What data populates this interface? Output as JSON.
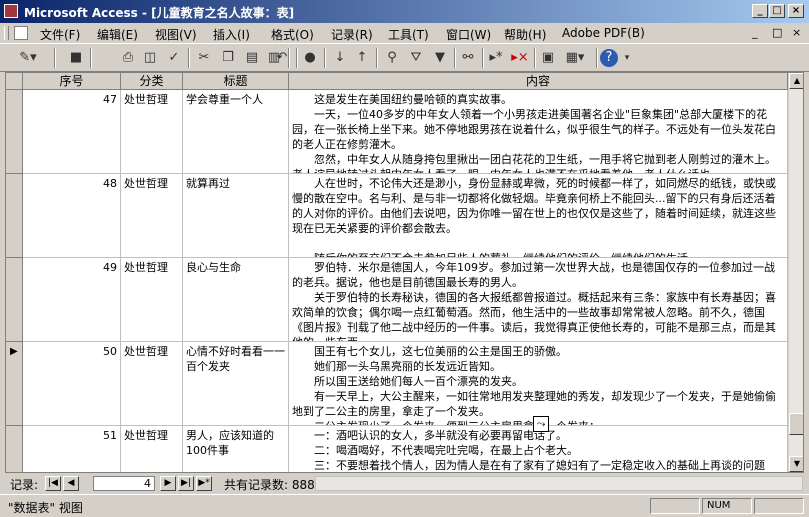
{
  "window": {
    "title": "Microsoft Access - [儿童教育之名人故事：表]",
    "minimize_glyph": "_",
    "restore_glyph": "□",
    "close_glyph": "×"
  },
  "menu": {
    "items": [
      "文件(F)",
      "编辑(E)",
      "视图(V)",
      "插入(I)",
      "格式(O)",
      "记录(R)",
      "工具(T)",
      "窗口(W)",
      "帮助(H)",
      "Adobe PDF(B)"
    ],
    "help_placeholder": "",
    "doc_controls": [
      "_",
      "□",
      "×"
    ]
  },
  "toolbar": {
    "icons": [
      "view-icon",
      "save-icon",
      "print-icon",
      "print-preview-icon",
      "spelling-icon",
      "cut-icon",
      "copy-icon",
      "paste-icon",
      "format-painter-icon",
      "undo-icon",
      "hyperlink-icon",
      "sort-ascending-icon",
      "sort-descending-icon",
      "filter-by-selection-icon",
      "filter-by-form-icon",
      "apply-filter-icon",
      "find-icon",
      "new-record-icon",
      "delete-record-icon",
      "database-window-icon",
      "new-object-icon",
      "help-icon"
    ]
  },
  "columns": [
    "序号",
    "分类",
    "标题",
    "内容"
  ],
  "rows": [
    {
      "num": "47",
      "category": "处世哲理",
      "title": "学会尊重一个人",
      "content": "　　这是发生在美国纽约曼哈顿的真实故事。\n　　一天，一位40多岁的中年女人领着一个小男孩走进美国著名企业\"巨象集团\"总部大厦楼下的花园，在一张长椅上坐下来。她不停地跟男孩在说着什么，似乎很生气的样子。不远处有一位头发花白的老人正在修剪灌木。\n　　忽然，中年女人从随身挎包里揪出一团白花花的卫生纸，一甩手将它抛到老人刚剪过的灌木上。老人诧异地转过头朝中年女人看了一眼。中年女人也满不在乎地看着他。老人什么话也"
    },
    {
      "num": "48",
      "category": "处世哲理",
      "title": "就算再过",
      "content": "　　人在世时，不论伟大还是渺小，身份显赫或卑微，死的时候都一样了，如同燃尽的纸钱，或快或慢的散在空中。名与利、是与非一切都将化做轻烟。毕竟亲何桥上不能回头...留下的只有身后还活着的人对你的评价。由他们去说吧，因为你唯一留在世上的也仅仅是这些了，随着时间延续，就连这些现在已无关紧要的评价都会散去。\n\n　　随后你的至交们不会去参加另些人的葬礼，继续他们的评价，继续他们的生活。"
    },
    {
      "num": "49",
      "category": "处世哲理",
      "title": "良心与生命",
      "content": "　　罗伯特．米尔是德国人，今年109岁。参加过第一次世界大战，也是德国仅存的一位参加过一战的老兵。据说，他也是目前德国最长寿的男人。\n　　关于罗伯特的长寿秘诀，德国的各大报纸都曾报道过。概括起来有三条：家族中有长寿基因；喜欢简单的饮食；偶尔喝一点红葡萄酒。然而，他生活中的一些故事却常常被人忽略。前不久，德国《图片报》刊载了他二战中经历的一件事。读后，我觉得真正使他长寿的，可能不是那三点，而是其他的一些东西。"
    },
    {
      "num": "50",
      "category": "处世哲理",
      "title": "心情不好时看看一一百个发夹",
      "content": "　　国王有七个女儿，这七位美丽的公主是国王的骄傲。\n　　她们那一头乌黑亮丽的长发远近皆知。\n　　所以国王送给她们每人一百个漂亮的发夹。\n　　有一天早上，大公主醒来，一如往常地用发夹整理她的秀发，却发现少了一个发夹，于是她偷偷地到了二公主的房里，拿走了一个发夹。\n　　二公主发现少了一个发夹，便到三公主房里拿走一个发夹；"
    },
    {
      "num": "51",
      "category": "处世哲理",
      "title": "男人，应该知道的100件事",
      "content": "　　一：酒吧认识的女人，多半就没有必要再留电话了。\n　　二：喝酒喝好，不代表喝完吐完喝，在最上占个老大。\n　　三：不要想着找个情人，因为情人是在有了家有了媳妇有了一定稳定收入的基础上再谈的问题"
    }
  ],
  "current_row_index": 3,
  "nav": {
    "label": "记录:",
    "current": "4",
    "total_label": "共有记录数: 888"
  },
  "status": {
    "text": "\"数据表\" 视图",
    "num": "NUM"
  }
}
